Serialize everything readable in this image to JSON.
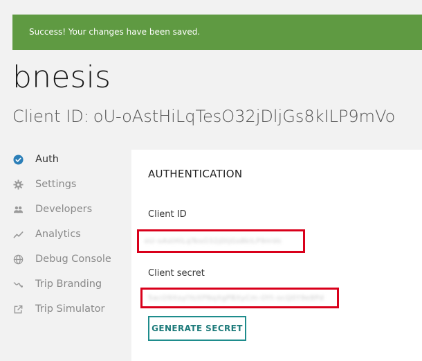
{
  "alert": {
    "message": "Success! Your changes have been saved.",
    "color": "#5f9a42"
  },
  "app": {
    "name": "bnesis",
    "client_id_label": "Client ID:",
    "client_id_value": "oU-oAstHiLqTesO32jDljGs8kILP9mVo"
  },
  "sidebar": {
    "items": [
      {
        "label": "Auth",
        "icon": "check-circle-icon",
        "active": true
      },
      {
        "label": "Settings",
        "icon": "gear-icon",
        "active": false
      },
      {
        "label": "Developers",
        "icon": "users-icon",
        "active": false
      },
      {
        "label": "Analytics",
        "icon": "trend-line-icon",
        "active": false
      },
      {
        "label": "Debug Console",
        "icon": "globe-icon",
        "active": false
      },
      {
        "label": "Trip Branding",
        "icon": "route-icon",
        "active": false
      },
      {
        "label": "Trip Simulator",
        "icon": "external-link-icon",
        "active": false
      }
    ]
  },
  "panel": {
    "title": "AUTHENTICATION",
    "client_id_label": "Client ID",
    "client_id_value": "eU-oAstHiLqTesO32jDljGs8kILP9mVo",
    "client_secret_label": "Client secret",
    "client_secret_value": "5acO9XoylYoXPNqXgPBXyCm-OYt-ocQ0Y9e8Pd",
    "generate_button": "GENERATE SECRET",
    "accent_color": "#1e8c8c",
    "redaction_color": "#d9001b"
  }
}
